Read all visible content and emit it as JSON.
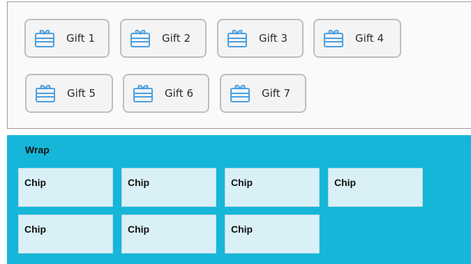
{
  "gifts": {
    "items": [
      {
        "label": "Gift 1",
        "icon": "gift-card-icon"
      },
      {
        "label": "Gift 2",
        "icon": "gift-card-icon"
      },
      {
        "label": "Gift 3",
        "icon": "gift-card-icon"
      },
      {
        "label": "Gift 4",
        "icon": "gift-card-icon"
      },
      {
        "label": "Gift 5",
        "icon": "gift-card-icon"
      },
      {
        "label": "Gift 6",
        "icon": "gift-card-icon"
      },
      {
        "label": "Gift 7",
        "icon": "gift-card-icon"
      }
    ],
    "icon_color": "#4a9fe0"
  },
  "wrap": {
    "title": "Wrap",
    "background": "#16b6d8",
    "chips": [
      {
        "label": "Chip"
      },
      {
        "label": "Chip"
      },
      {
        "label": "Chip"
      },
      {
        "label": "Chip"
      },
      {
        "label": "Chip"
      },
      {
        "label": "Chip"
      },
      {
        "label": "Chip"
      }
    ]
  }
}
